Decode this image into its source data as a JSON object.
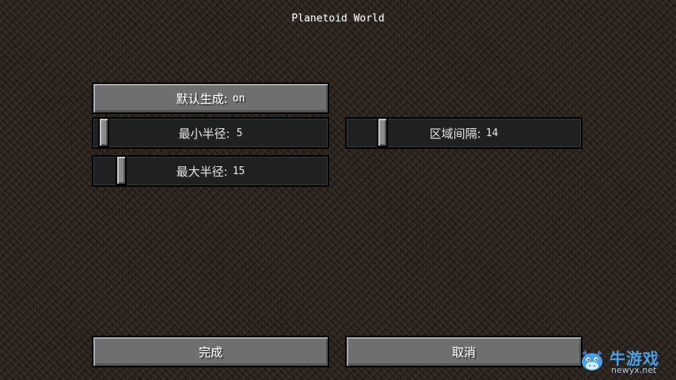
{
  "screen": {
    "title": "Planetoid World"
  },
  "options": {
    "default_gen": {
      "label": "默认生成:",
      "value": "on"
    },
    "min_radius": {
      "label": "最小半径:",
      "value": "5",
      "level": 0.0
    },
    "region_spacing": {
      "label": "区域间隔:",
      "value": "14",
      "level": 0.13
    },
    "max_radius": {
      "label": "最大半径:",
      "value": "15",
      "level": 0.1
    }
  },
  "footer": {
    "done_label": "完成",
    "cancel_label": "取消"
  },
  "watermark": {
    "name": "牛游戏",
    "url": "newyx.net",
    "color": "#4aa0e8"
  },
  "icons": {
    "watermark_logo": "cartoon-bull-logo-icon"
  }
}
